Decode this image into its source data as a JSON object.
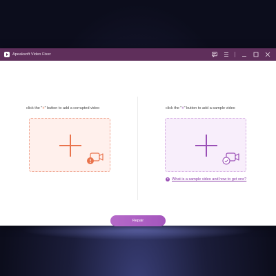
{
  "window": {
    "title": "Apeaksoft Video Fixer"
  },
  "titlebar_icons": [
    "feedback-icon",
    "menu-icon",
    "minimize-icon",
    "maximize-icon",
    "close-icon"
  ],
  "left_panel": {
    "label_prefix": "click the \"",
    "label_plus": "+",
    "label_suffix": "\" button to add a corrupted video",
    "plus_color": "#e9734c",
    "zone_bg": "#fff0ec",
    "badge_icon": "corrupted-video-icon"
  },
  "right_panel": {
    "label_prefix": "click the \"",
    "label_plus": "+",
    "label_suffix": "\" button to add a sample video",
    "plus_color": "#9a4fb6",
    "zone_bg": "#f8eefb",
    "badge_icon": "sample-video-icon",
    "help_icon_glyph": "?",
    "help_link": "What is a sample video and how to get one?"
  },
  "repair_button": {
    "label": "Repair",
    "color": "#b56ac9"
  },
  "colors": {
    "titlebar": "#5f2f5b",
    "accent": "#9a4fb6"
  }
}
